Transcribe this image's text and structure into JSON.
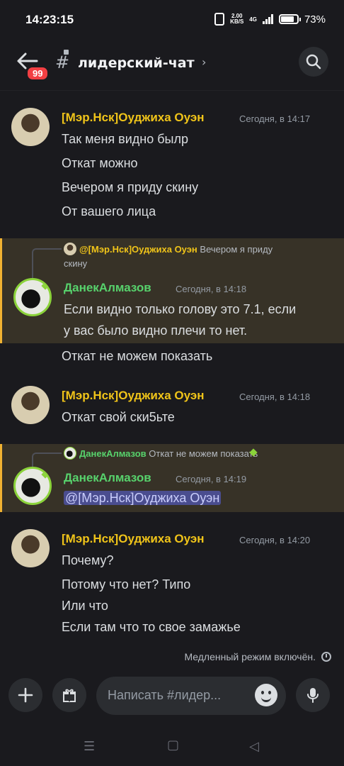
{
  "status_bar": {
    "time": "14:23:15",
    "net_speed_top": "2.00",
    "net_speed_bottom": "KB/S",
    "net_type": "4G",
    "battery": "73%"
  },
  "header": {
    "unread_badge": "99",
    "channel_symbol": "#",
    "channel_name": "лидерский-чат",
    "chevron": "›"
  },
  "messages": [
    {
      "author": "[Мэр.Нск]Оуджиха Оуэн",
      "timestamp": "Сегодня, в 14:17",
      "lines": [
        "Так меня видно былр",
        "Откат можно",
        "Вечером я приду скину",
        "От вашего лица"
      ]
    },
    {
      "reply": {
        "author": "@[Мэр.Нск]Оуджиха Оуэн",
        "text_1": "Вечером я приду",
        "text_2": "скину"
      },
      "author": "ДанекАлмазов",
      "timestamp": "Сегодня, в 14:18",
      "lines": [
        "Если видно только голову это 7.1, если",
        "у вас было видно плечи то нет."
      ]
    },
    {
      "lines": [
        "Откат не можем показать"
      ]
    },
    {
      "author": "[Мэр.Нск]Оуджиха Оуэн",
      "timestamp": "Сегодня, в 14:18",
      "lines": [
        "Откат свой ски5ьте"
      ]
    },
    {
      "reply": {
        "author": "ДанекАлмазов",
        "text": "Откат не можем показать"
      },
      "author": "ДанекАлмазов",
      "timestamp": "Сегодня, в 14:19",
      "mention": "@[Мэр.Нск]Оуджиха Оуэн"
    },
    {
      "author": "[Мэр.Нск]Оуджиха Оуэн",
      "timestamp": "Сегодня, в 14:20",
      "lines": [
        "Почему?",
        "Потому что нет? Типо",
        "Или что",
        "Если там что то свое замажье"
      ]
    }
  ],
  "slowmode": "Медленный режим включён.",
  "composer": {
    "placeholder": "Написать #лидер..."
  },
  "colors": {
    "background": "#1a1a1e",
    "role_yellow": "#f0c419",
    "role_green": "#57d26c",
    "highlight_bar": "#f0b232",
    "mention_bg": "#4a4d8f",
    "badge_red": "#f23f43"
  },
  "icons": [
    "back-arrow-icon",
    "hash-lock-icon",
    "search-icon",
    "plus-icon",
    "gift-icon",
    "emoji-icon",
    "microphone-icon",
    "recents-nav-icon",
    "home-nav-icon",
    "back-nav-icon",
    "timer-icon"
  ]
}
